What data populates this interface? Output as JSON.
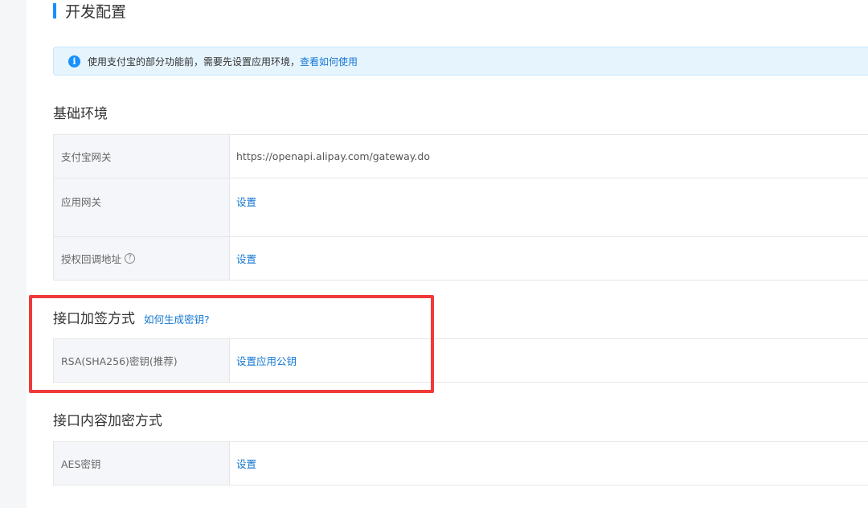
{
  "page_title": "开发配置",
  "notice": {
    "text": "使用支付宝的部分功能前，需要先设置应用环境，",
    "link": "查看如何使用"
  },
  "basic_env": {
    "title": "基础环境",
    "rows": [
      {
        "label": "支付宝网关",
        "value": "https://openapi.alipay.com/gateway.do"
      },
      {
        "label": "应用网关",
        "value": "设置"
      },
      {
        "label": "授权回调地址",
        "value": "设置",
        "help_icon": "?"
      }
    ]
  },
  "sign_method": {
    "title": "接口加签方式",
    "help_link": "如何生成密钥?",
    "rows": [
      {
        "label": "RSA(SHA256)密钥(推荐)",
        "value": "设置应用公钥"
      }
    ]
  },
  "encrypt_method": {
    "title": "接口内容加密方式",
    "rows": [
      {
        "label": "AES密钥",
        "value": "设置"
      }
    ]
  },
  "colors": {
    "accent": "#1890ff",
    "link": "#1677d2",
    "highlight": "#f03a3a"
  }
}
